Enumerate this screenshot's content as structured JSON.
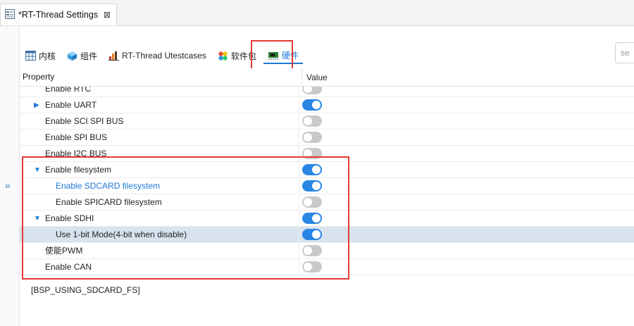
{
  "editor": {
    "tab_title": "*RT-Thread Settings",
    "close_glyph": "⊠"
  },
  "tabs": [
    {
      "label": "内核",
      "icon": "table-icon"
    },
    {
      "label": "组件",
      "icon": "cube-icon"
    },
    {
      "label": "RT-Thread Utestcases",
      "icon": "chart-icon"
    },
    {
      "label": "软件包",
      "icon": "flower-icon"
    },
    {
      "label": "硬件",
      "icon": "board-icon",
      "active": true
    }
  ],
  "search": {
    "placeholder": "se"
  },
  "table": {
    "col_property": "Property",
    "col_value": "Value"
  },
  "rows": [
    {
      "label": "Enable RTC",
      "enabled": false
    },
    {
      "label": "Enable UART",
      "enabled": true,
      "expander": "collapsed"
    },
    {
      "label": "Enable SCI SPI BUS",
      "enabled": false
    },
    {
      "label": "Enable SPI BUS",
      "enabled": false
    },
    {
      "label": "Enable I2C BUS",
      "enabled": false
    },
    {
      "label": "Enable filesystem",
      "enabled": true,
      "expander": "expanded"
    },
    {
      "label": "Enable SDCARD filesystem",
      "enabled": true,
      "child": true,
      "link": true
    },
    {
      "label": "Enable SPICARD filesystem",
      "enabled": false,
      "child": true
    },
    {
      "label": "Enable SDHI",
      "enabled": true,
      "expander": "expanded"
    },
    {
      "label": "Use 1-bit Mode(4-bit when disable)",
      "enabled": true,
      "child": true,
      "selected": true
    },
    {
      "label": "使能PWM",
      "enabled": false
    },
    {
      "label": "Enable CAN",
      "enabled": false
    }
  ],
  "description": "[BSP_USING_SDCARD_FS]",
  "colors": {
    "accent": "#1e78d7",
    "toggle_on": "#2a86e5",
    "toggle_off": "#c9c9c9",
    "highlight": "#e53935",
    "selected_row": "#d8e3ee"
  }
}
